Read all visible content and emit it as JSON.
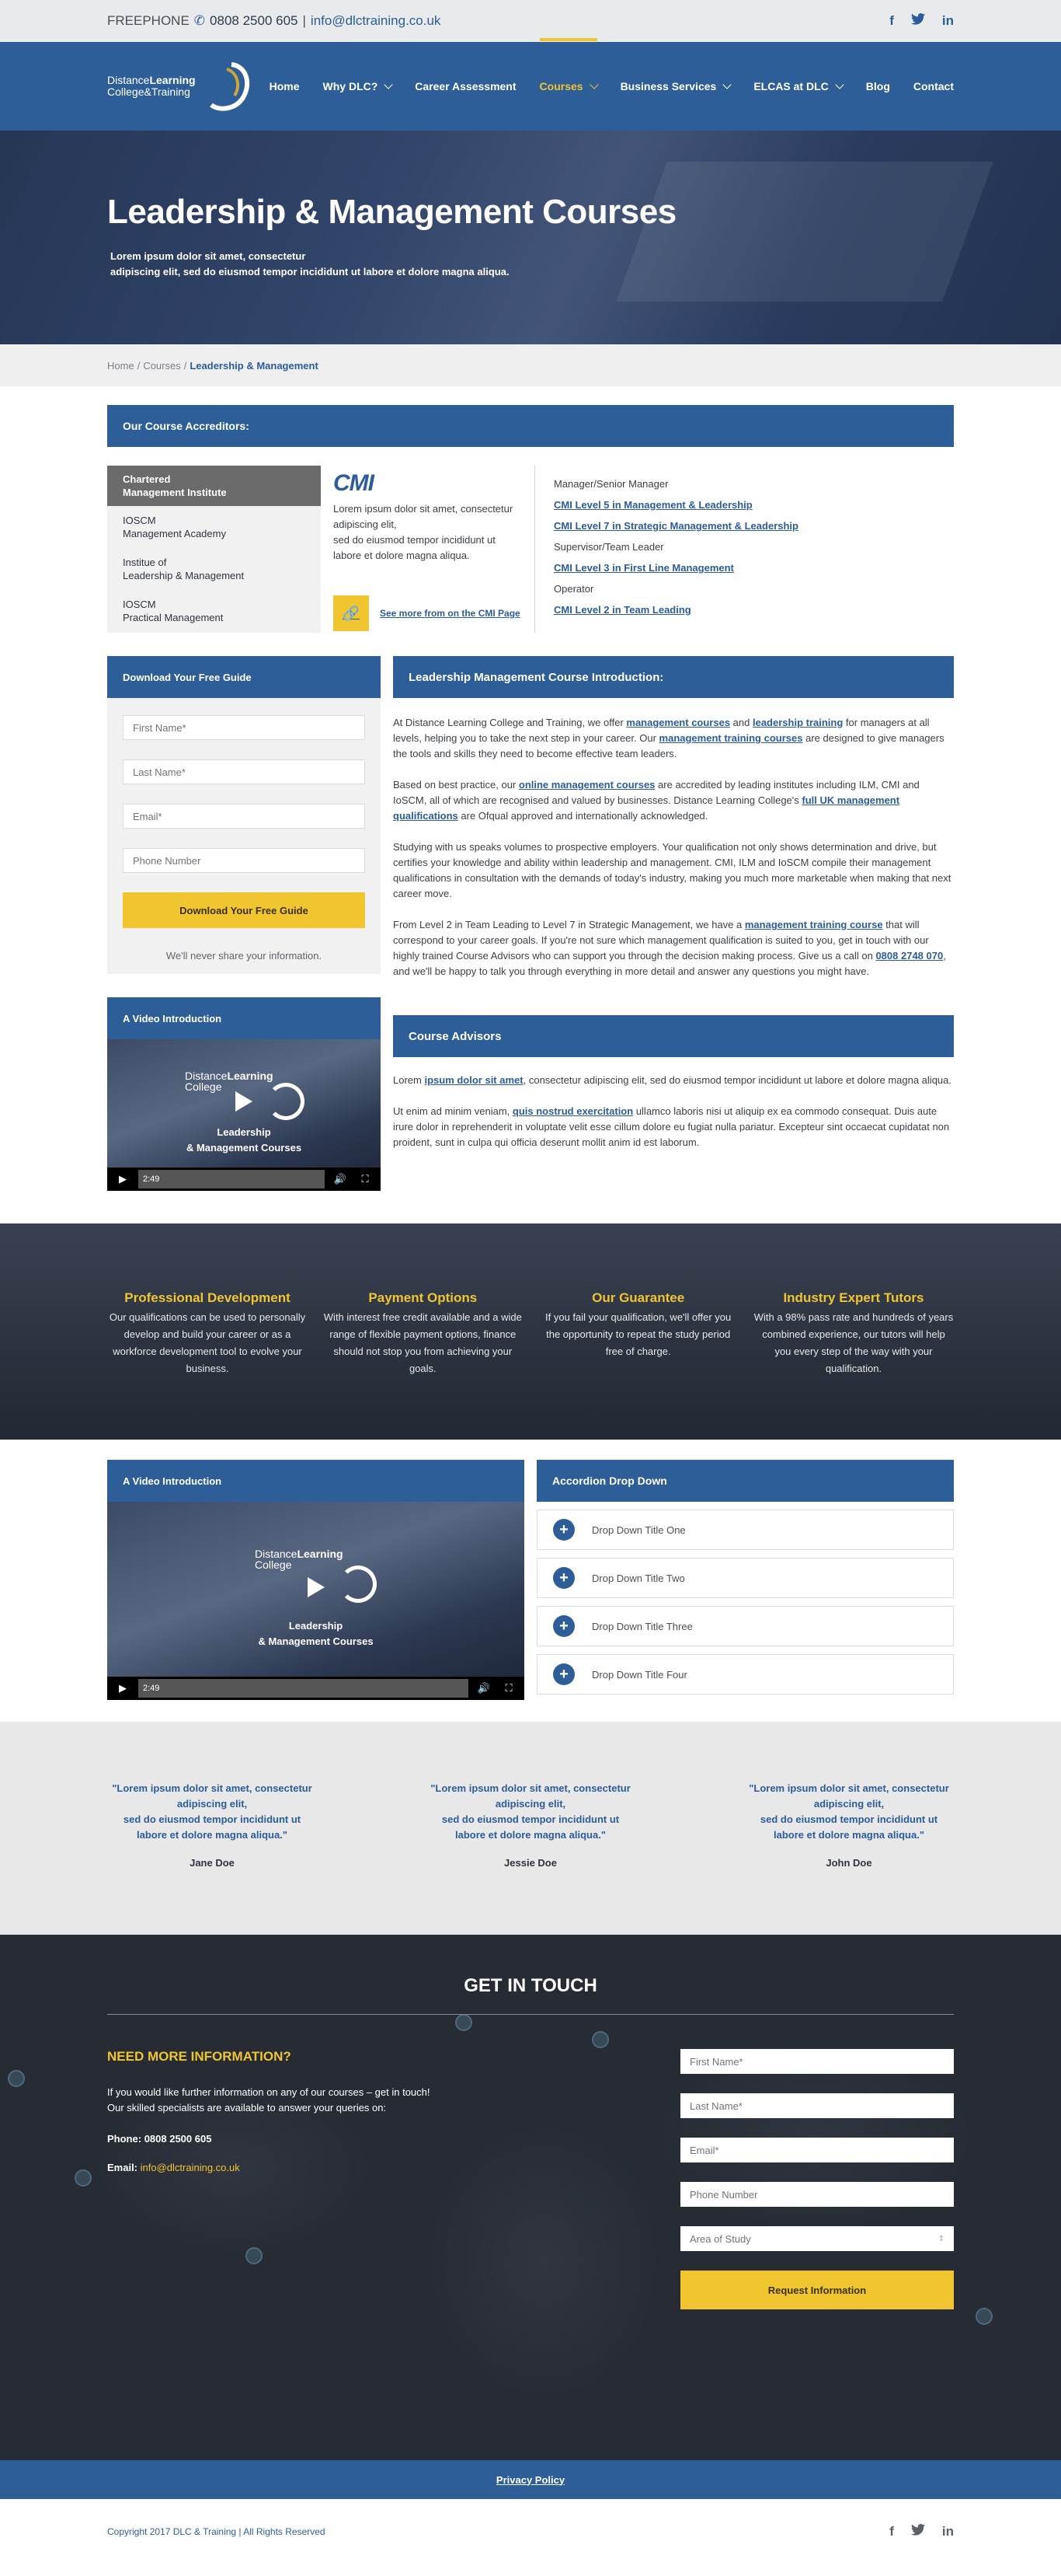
{
  "topbar": {
    "freephone_label": "FREEPHONE",
    "phone": "0808 2500 605",
    "separator": "|",
    "email": "info@dlctraining.co.uk",
    "social": [
      "f",
      "t",
      "in"
    ]
  },
  "logo": {
    "line1_a": "Distance",
    "line1_b": "Learning",
    "line2": "College&Training"
  },
  "nav": {
    "items": [
      {
        "label": "Home",
        "dropdown": false,
        "active": false
      },
      {
        "label": "Why DLC?",
        "dropdown": true,
        "active": false
      },
      {
        "label": "Career Assessment",
        "dropdown": false,
        "active": false
      },
      {
        "label": "Courses",
        "dropdown": true,
        "active": true
      },
      {
        "label": "Business Services",
        "dropdown": true,
        "active": false
      },
      {
        "label": "ELCAS at DLC",
        "dropdown": true,
        "active": false
      },
      {
        "label": "Blog",
        "dropdown": false,
        "active": false
      },
      {
        "label": "Contact",
        "dropdown": false,
        "active": false
      }
    ]
  },
  "hero": {
    "title": "Leadership & Management Courses",
    "line1": "Lorem ipsum dolor sit amet, consectetur",
    "line2": "adipiscing elit, sed do eiusmod tempor incididunt ut labore et dolore magna aliqua."
  },
  "breadcrumb": {
    "home": "Home",
    "courses": "Courses",
    "current": "Leadership & Management",
    "sep": " / "
  },
  "accreditors": {
    "title": "Our Course Accreditors:",
    "tabs": [
      {
        "l1": "Chartered",
        "l2": "Management Institute",
        "active": true
      },
      {
        "l1": "IOSCM",
        "l2": "Management Academy",
        "active": false
      },
      {
        "l1": "Institue of",
        "l2": "Leadership & Management",
        "active": false
      },
      {
        "l1": "IOSCM",
        "l2": "Practical Management",
        "active": false
      }
    ],
    "logo_text": "CMI",
    "desc1": "Lorem ipsum dolor sit amet, consectetur adipiscing elit,",
    "desc2": "sed do eiusmod tempor incididunt ut labore et dolore magna aliqua.",
    "link": "See more from on the CMI Page",
    "courses": [
      {
        "text": "Manager/Senior Manager",
        "link": false
      },
      {
        "text": "CMI Level 5 in Management & Leadership",
        "link": true
      },
      {
        "text": "CMI Level 7 in Strategic Management & Leadership",
        "link": true
      },
      {
        "text": "Supervisor/Team Leader",
        "link": false
      },
      {
        "text": "CMI Level 3 in First Line Management",
        "link": true
      },
      {
        "text": "Operator",
        "link": false
      },
      {
        "text": "CMI Level 2 in Team Leading",
        "link": true
      }
    ]
  },
  "guide": {
    "title": "Download Your Free Guide",
    "first": "First Name*",
    "last": "Last Name*",
    "email": "Email*",
    "phone": "Phone Number",
    "button": "Download Your Free Guide",
    "note": "We'll never share your information."
  },
  "intro": {
    "title": "Leadership Management Course Introduction:",
    "p1a": "At Distance Learning College and Training, we offer ",
    "p1l1": "management courses",
    "p1b": " and ",
    "p1l2": "leadership training",
    "p1c": " for managers at all levels, helping you to take the next step in your career. Our ",
    "p1l3": "management training courses",
    "p1d": " are designed to give managers the tools and skills they need to become effective team leaders.",
    "p2a": "Based on best practice, our ",
    "p2l1": "online management courses",
    "p2b": " are accredited by leading institutes including ILM, CMI and IoSCM, all of which are recognised and valued by businesses. Distance Learning College's ",
    "p2l2": "full UK management qualifications",
    "p2c": " are Ofqual approved and internationally acknowledged.",
    "p3": "Studying with us speaks volumes to prospective employers. Your qualification not only shows determination and drive, but certifies your knowledge and ability within leadership and management. CMI, ILM and IoSCM compile their management qualifications in consultation with the demands of today's industry, making you much more marketable when making that next career move.",
    "p4a": "From Level 2 in Team Leading to Level 7 in Strategic Management, we have a ",
    "p4l1": "management training course",
    "p4b": " that will correspond to your career goals. If you're not sure which management qualification is suited to you, get in touch with our highly trained Course Advisors who can support you through the decision making process. Give us a call on ",
    "p4l2": "0808 2748 070",
    "p4c": ", and we'll be happy to talk you through everything in more detail and answer any questions you might have."
  },
  "video1": {
    "title": "A Video Introduction",
    "logo_a": "Distance",
    "logo_b": "Learning",
    "logo_c": "College",
    "cap1": "Leadership",
    "cap2": "& Management Courses",
    "time": "2:49"
  },
  "advisors": {
    "title": "Course Advisors",
    "p1a": "Lorem ",
    "p1l": "ipsum dolor sit amet",
    "p1b": ", consectetur adipiscing elit, sed do eiusmod tempor incididunt ut labore et dolore magna aliqua.",
    "p2a": "Ut enim ad minim veniam, ",
    "p2l": "quis nostrud exercitation",
    "p2b": " ullamco laboris nisi ut aliquip ex ea commodo consequat. Duis aute irure dolor in reprehenderit in voluptate velit esse cillum dolore eu fugiat nulla pariatur. Excepteur sint occaecat cupidatat non proident, sunt in culpa qui officia deserunt mollit anim id est laborum."
  },
  "features": [
    {
      "title": "Professional Development",
      "text": "Our qualifications can be used to personally develop and build your career or as a workforce development tool to evolve your business."
    },
    {
      "title": "Payment Options",
      "text": "With interest free credit available and a wide range of flexible payment options, finance should not stop you from achieving your goals."
    },
    {
      "title": "Our Guarantee",
      "text": "If you fail your qualification, we'll offer you the opportunity to repeat the study period free of charge."
    },
    {
      "title": "Industry Expert Tutors",
      "text": "With a 98% pass rate and hundreds of years combined experience, our tutors will help you every step of the way with your qualification."
    }
  ],
  "video2": {
    "title": "A Video Introduction",
    "time": "2:49"
  },
  "accordion": {
    "title": "Accordion Drop Down",
    "items": [
      "Drop Down Title One",
      "Drop Down Title Two",
      "Drop Down Title Three",
      "Drop Down Title Four"
    ]
  },
  "testimonials": [
    {
      "l1": "\"Lorem ipsum dolor sit amet, consectetur",
      "l2": "adipiscing elit,",
      "l3": "sed do eiusmod tempor incididunt ut",
      "l4": "labore et dolore magna aliqua.\"",
      "name": "Jane Doe"
    },
    {
      "l1": "\"Lorem ipsum dolor sit amet, consectetur",
      "l2": "adipiscing elit,",
      "l3": "sed do eiusmod tempor incididunt ut",
      "l4": "labore et dolore magna aliqua.\"",
      "name": "Jessie Doe"
    },
    {
      "l1": "\"Lorem ipsum dolor sit amet, consectetur",
      "l2": "adipiscing elit,",
      "l3": "sed do eiusmod tempor incididunt ut",
      "l4": "labore et dolore magna aliqua.\"",
      "name": "John Doe"
    }
  ],
  "contact": {
    "title": "GET IN TOUCH",
    "heading": "NEED MORE INFORMATION?",
    "text": "If you would like further information on any of our courses – get in touch! Our skilled specialists are available to answer your queries on:",
    "phone_label": "Phone:",
    "phone": "0808 2500 605",
    "email_label": "Email:",
    "email": "info@dlctraining.co.uk",
    "form": {
      "first": "First Name*",
      "last": "Last Name*",
      "email": "Email*",
      "phone": "Phone Number",
      "area": "Area of Study",
      "button": "Request Information"
    }
  },
  "footer": {
    "privacy": "Privacy Policy",
    "copyright": "Copyright 2017 DLC & Training | All Rights Reserved",
    "social": [
      "f",
      "t",
      "in"
    ]
  }
}
